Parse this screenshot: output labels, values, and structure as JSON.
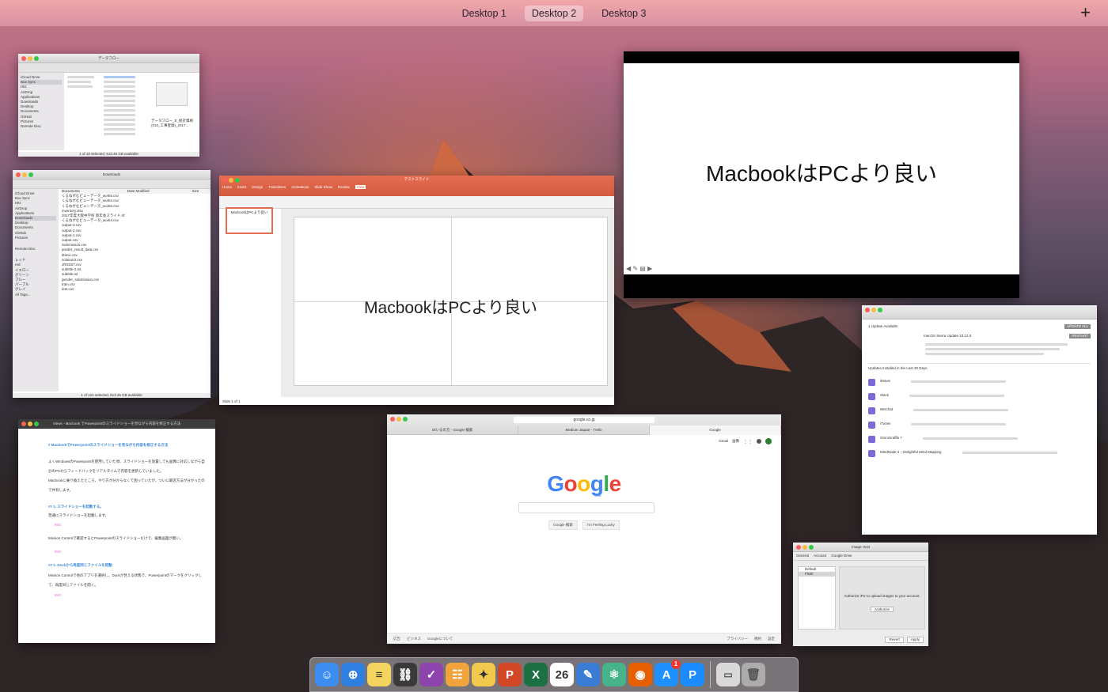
{
  "spaces": {
    "tabs": [
      "Desktop 1",
      "Desktop 2",
      "Desktop 3"
    ],
    "active_index": 1,
    "add_label": "+"
  },
  "windows": {
    "finder_dataflow": {
      "title": "データフロー",
      "sidebar": [
        "iCloud Drive",
        "Box Sync",
        "Hitz",
        "AirDrop",
        "Applications",
        "Downloads",
        "Desktop",
        "Documents",
        "GitHub",
        "Pictures",
        "Remote Disc"
      ],
      "preview_title": "データフロー_E_統計資格(010_工事登録)_2017...",
      "status": "1 of 18 selected, 513.46 GB available"
    },
    "finder_downloads": {
      "title": "Downloads",
      "columns": [
        "Documents",
        "Date Modified",
        "Size"
      ],
      "files": [
        "くるねずむビューデータ_work5.csv",
        "くるねずむビューデータ_work2.csv",
        "くるねずむビューデータ_work5.csv",
        "inventory.xlsx",
        "2017年度大阪中学校 新年会スライド.rtf",
        "くるねずむビューデータ_work4.csv",
        "output-3.csv",
        "output-2.csv",
        "output-1.csv",
        "output.csv",
        "Submission.csv",
        "predict_result_data.csv",
        "titanic.csv",
        "solution3.csv",
        "JRSD27.csv",
        "subtitle-2.txt",
        "subtitle.txt",
        "gender_submission.csv",
        "train.csv",
        "test.csv"
      ],
      "tags": [
        "レッド",
        "red",
        "イエロー",
        "グリーン",
        "ブルー",
        "パープル",
        "グレイ",
        "All Tags..."
      ],
      "status": "1 of 121 selected, 513.46 GB available"
    },
    "powerpoint": {
      "title": "テストスライド",
      "tabs": [
        "Home",
        "Insert",
        "Design",
        "Transitions",
        "Animations",
        "Slide Show",
        "Review",
        "View"
      ],
      "slide_text": "MacbookはPCより良い",
      "thumb_text": "MacbookはPCより良い",
      "status": "Slide 1 of 1"
    },
    "keynote_fullscreen": {
      "slide_text": "MacbookはPCより良い"
    },
    "app_store_updates": {
      "header": "1 Update Available",
      "update_all": "UPDATE ALL",
      "update_item": "macOS Sierra Update 10.12.5",
      "restart": "RESTART",
      "installed_header": "Updates Installed in the Last 30 Days",
      "apps": [
        "iMovie",
        "Slack",
        "WeChat",
        "iTunes",
        "OmniGraffle 7",
        "MindNode 2 – Delightful Mind Mapping"
      ]
    },
    "blog_editor": {
      "title": "Views - Macbook でPowerpointのスライドショーを見ながら内容を修正する方法",
      "heading": "# MacbookでPowerpointのスライドショーを見ながら内容を修正する方法",
      "para1": "よくWindowsのPowerpointを使用していた頃、スライドショーを放置しても画像に対応しながら自分のPCからフィードバックをリアルタイムで内容を更新していました。",
      "para2": "Macbookに乗り換えたところ、やり方が分からなくて困っていたが、ついに最近方法が分かったので共有します。",
      "h1": "## 1. スライドショーを起動する。",
      "p3": "普通にスライドショーを起動します。",
      "img": "IMG",
      "p4": "Mission Controlで確認するとPowerpointのスライドショーだけで、編集画面が無い。",
      "h2": "## 2. Dockから再度同じファイルを起動",
      "p5": "Mission Controlで他のアプリを選択し、Dockが見える状態で、Powerpointのマークをクリックして、再度同じファイルを開く。"
    },
    "safari_google": {
      "url": "google.co.jp",
      "tabs": [
        "Ofいるの方 - Google 検索",
        "Medium Jaquar - Trello",
        "Google"
      ],
      "top_links": [
        "Gmail",
        "画像"
      ],
      "logo": "Google",
      "logo_sub": "日本",
      "btn_search": "Google 検索",
      "btn_lucky": "I'm Feeling Lucky",
      "footer_left": [
        "広告",
        "ビジネス",
        "Googleについて"
      ],
      "footer_right": [
        "プライバシー",
        "規約",
        "設定"
      ]
    },
    "image_host": {
      "title": "Image Host",
      "toolbar": [
        "General",
        "Account",
        "Google Drive"
      ],
      "list": [
        "Default",
        "Flickr"
      ],
      "message": "Authorize iPic to upload images to your account.",
      "authorize": "Authorize",
      "revert": "Revert",
      "apply": "Apply"
    }
  },
  "dock": {
    "apps": [
      {
        "name": "Finder",
        "color": "#3d8df0",
        "glyph": "☺"
      },
      {
        "name": "Safari",
        "color": "#2f7fe0",
        "glyph": "⊕"
      },
      {
        "name": "Notes",
        "color": "#f4d35e",
        "glyph": "≡"
      },
      {
        "name": "VPN",
        "color": "#3a3a3a",
        "glyph": "⛓"
      },
      {
        "name": "OmniFocus",
        "color": "#8e44ad",
        "glyph": "✓"
      },
      {
        "name": "Tasks",
        "color": "#f1a33c",
        "glyph": "☷"
      },
      {
        "name": "Tes",
        "color": "#f2c94c",
        "glyph": "✦"
      },
      {
        "name": "PowerPoint",
        "color": "#d24726",
        "glyph": "P"
      },
      {
        "name": "Excel",
        "color": "#1d7044",
        "glyph": "X"
      },
      {
        "name": "Calendar",
        "color": "#ffffff",
        "glyph": "26"
      },
      {
        "name": "Kindle",
        "color": "#3a7bd5",
        "glyph": "✎"
      },
      {
        "name": "Atom",
        "color": "#46b38a",
        "glyph": "⚛"
      },
      {
        "name": "Firefox",
        "color": "#e66000",
        "glyph": "◉"
      },
      {
        "name": "App Store",
        "color": "#1e90ff",
        "glyph": "A"
      },
      {
        "name": "iPic",
        "color": "#1a8cff",
        "glyph": "P"
      }
    ],
    "app_store_badge": "1",
    "trash_glyph": "🗑"
  },
  "colors": {
    "ppt_orange": "#d35b40",
    "blog_heading": "#3c8ad8",
    "img_tag": "#e26ad6"
  }
}
